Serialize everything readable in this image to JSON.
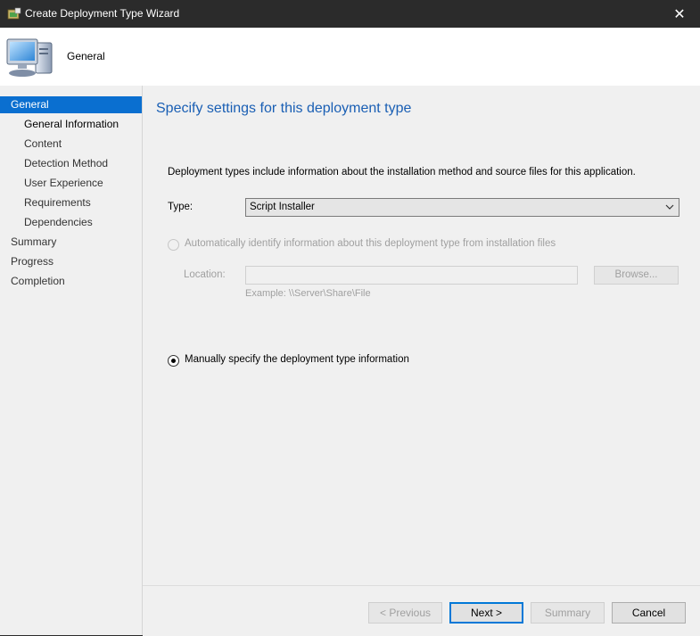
{
  "window": {
    "title": "Create Deployment Type Wizard",
    "close_icon": "close-icon"
  },
  "header": {
    "title": "General",
    "icon": "computer-icon"
  },
  "nav": {
    "items": [
      {
        "label": "General",
        "level": "top",
        "state": "active"
      },
      {
        "label": "General Information",
        "level": "sub",
        "state": "current"
      },
      {
        "label": "Content",
        "level": "sub",
        "state": "normal"
      },
      {
        "label": "Detection Method",
        "level": "sub",
        "state": "normal"
      },
      {
        "label": "User Experience",
        "level": "sub",
        "state": "normal"
      },
      {
        "label": "Requirements",
        "level": "sub",
        "state": "normal"
      },
      {
        "label": "Dependencies",
        "level": "sub",
        "state": "normal"
      },
      {
        "label": "Summary",
        "level": "top",
        "state": "normal"
      },
      {
        "label": "Progress",
        "level": "top",
        "state": "normal"
      },
      {
        "label": "Completion",
        "level": "top",
        "state": "normal"
      }
    ]
  },
  "main": {
    "heading": "Specify settings for this deployment type",
    "description": "Deployment types include information about the installation method and source files for this application.",
    "type_label": "Type:",
    "type_value": "Script Installer",
    "auto_option": {
      "label": "Automatically identify information about this deployment type from installation files",
      "selected": false,
      "enabled": false
    },
    "location_label": "Location:",
    "location_value": "",
    "browse_label": "Browse...",
    "example_text": "Example: \\\\Server\\Share\\File",
    "manual_option": {
      "label": "Manually specify the deployment type information",
      "selected": true,
      "enabled": true
    }
  },
  "footer": {
    "previous_label": "< Previous",
    "next_label": "Next >",
    "summary_label": "Summary",
    "cancel_label": "Cancel"
  },
  "colors": {
    "accent": "#0a6fd0",
    "heading": "#1a5fb4",
    "titlebar": "#2b2b2b"
  }
}
